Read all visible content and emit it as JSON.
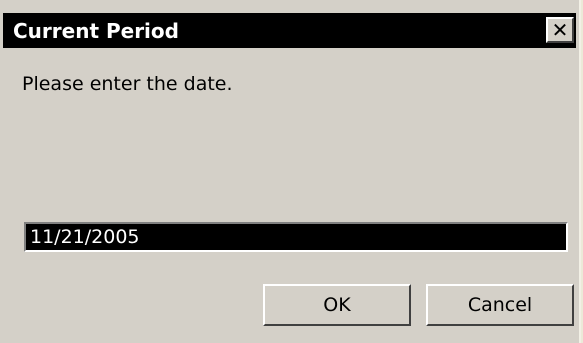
{
  "dialog": {
    "title": "Current Period",
    "close_label": "✕",
    "prompt": "Please enter the date.",
    "date_value": "11/21/2005",
    "ok_label": "OK",
    "cancel_label": "Cancel"
  },
  "colors": {
    "face": "#d4d0c8",
    "titlebar": "#000000",
    "input_bg": "#000000",
    "input_text": "#ffffff"
  }
}
